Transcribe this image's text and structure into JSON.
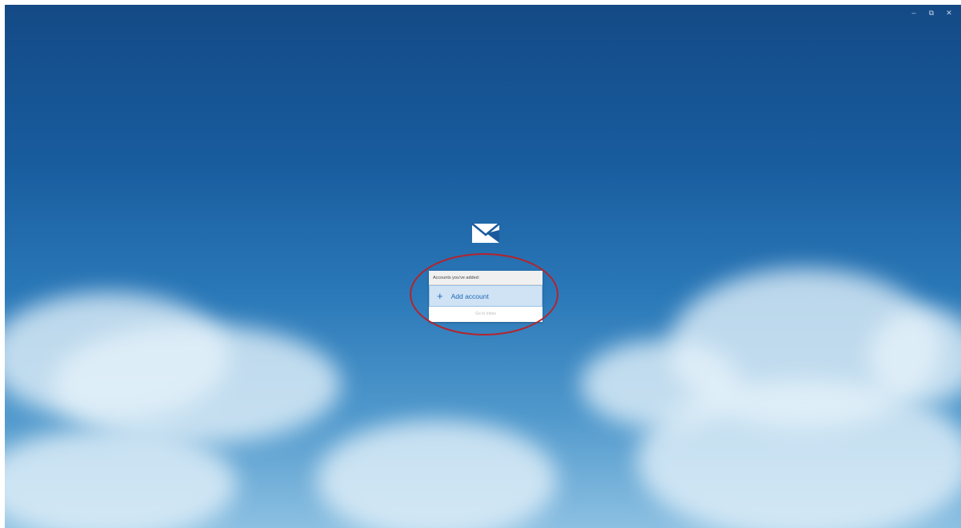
{
  "window": {
    "controls": {
      "minimize_symbol": "–",
      "restore_symbol": "⧉",
      "close_symbol": "✕"
    }
  },
  "app": {
    "logo_icon": "mail-envelope-icon"
  },
  "accounts_dialog": {
    "header": "Accounts you've added:",
    "add_account_icon": "plus-icon",
    "add_account_label": "Add account",
    "go_to_inbox_label": "Go to Inbox"
  },
  "annotation": {
    "color": "#b3242c",
    "shape": "ellipse"
  },
  "colors": {
    "sky_top": "#144a86",
    "sky_bottom": "#8cc0e2",
    "add_account_bg": "#cfe3f5",
    "add_account_text": "#1f66b7"
  }
}
